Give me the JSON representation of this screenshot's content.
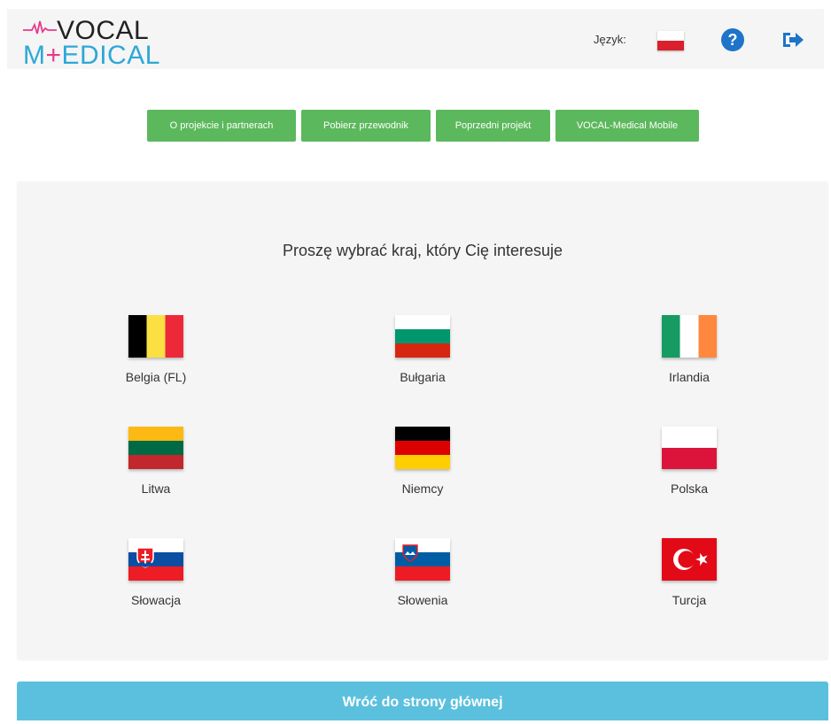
{
  "header": {
    "logo_line1": "VOCAL",
    "logo_line2_pre": "M",
    "logo_line2_plus": "+",
    "logo_line2_post": "EDICAL",
    "language_label": "Język:"
  },
  "nav": {
    "buttons": [
      {
        "label": "O projekcie i partnerach"
      },
      {
        "label": "Pobierz przewodnik"
      },
      {
        "label": "Poprzedni projekt"
      },
      {
        "label": "VOCAL-Medical Mobile"
      }
    ]
  },
  "main": {
    "title": "Proszę wybrać kraj, który Cię interesuje",
    "countries": [
      {
        "name": "Belgia (FL)"
      },
      {
        "name": "Bułgaria"
      },
      {
        "name": "Irlandia"
      },
      {
        "name": "Litwa"
      },
      {
        "name": "Niemcy"
      },
      {
        "name": "Polska"
      },
      {
        "name": "Słowacja"
      },
      {
        "name": "Słowenia"
      },
      {
        "name": "Turcja"
      }
    ]
  },
  "back_button": {
    "label": "Wróć do strony głównej"
  },
  "colors": {
    "nav_green": "#5cb85c",
    "back_blue": "#5bc0de",
    "help_blue": "#1e74c8",
    "logo_blue": "#2ea8d6",
    "logo_pink": "#e8388a"
  },
  "icons": {
    "help": "question-circle-icon",
    "logout": "sign-out-icon",
    "language": "polish-flag-icon"
  }
}
